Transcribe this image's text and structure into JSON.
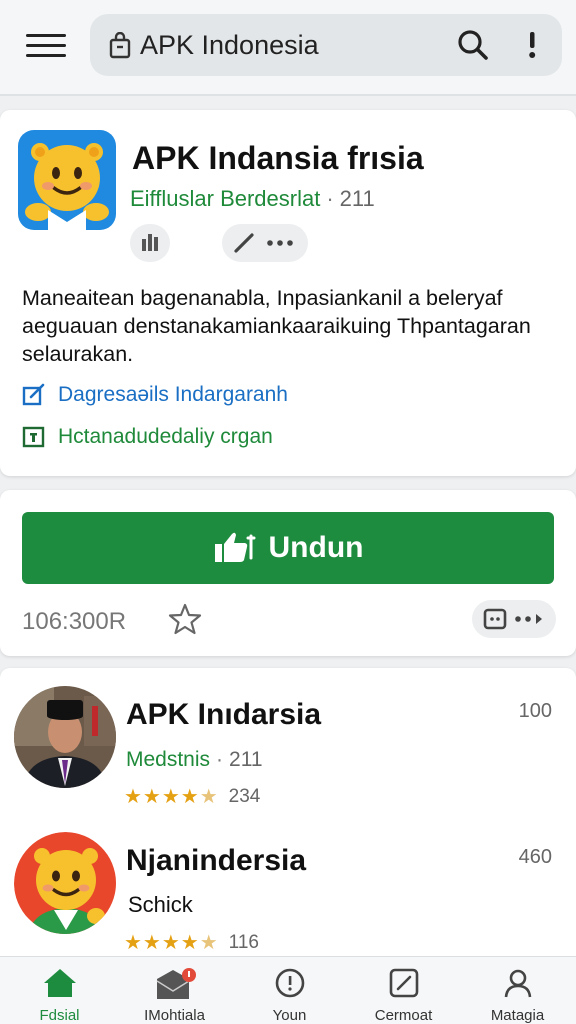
{
  "search": {
    "text": "APK Indonesia"
  },
  "app": {
    "title": "APK Indansia frısia",
    "developer": "Eiffluslar Berdesrlat",
    "developer_count": "211",
    "description": "Maneaitean bagenanabla, Inpasiankanil a beleryaf aeguauan denstanakamiankaaraikuing Thpantagaran selaurakan.",
    "link1": "Dagresaəils Indargaranh",
    "link2": "Hctanadudedaliy crgan"
  },
  "download": {
    "button_label": "Undun",
    "size": "106:300R"
  },
  "list": [
    {
      "title": "APK Inıdarsia",
      "subtitle": "Medstnis",
      "count": "211",
      "rating": 4.5,
      "reviews": "234",
      "number": "100"
    },
    {
      "title": "Njanindersia",
      "subtitle": "Schick",
      "rating": 4.5,
      "reviews": "116",
      "number": "460"
    }
  ],
  "nav": [
    {
      "label": "Fdsial",
      "icon": "home-icon",
      "active": true
    },
    {
      "label": "IMohtiala",
      "icon": "mail-icon",
      "badge": "0"
    },
    {
      "label": "Youn",
      "icon": "clock-icon"
    },
    {
      "label": "Cermoat",
      "icon": "edit-icon"
    },
    {
      "label": "Matagia",
      "icon": "person-icon"
    }
  ],
  "colors": {
    "accent": "#1e8c3f",
    "link": "#1a6fc4",
    "star": "#e5a114",
    "icon_bg": "#1f8ae0"
  }
}
